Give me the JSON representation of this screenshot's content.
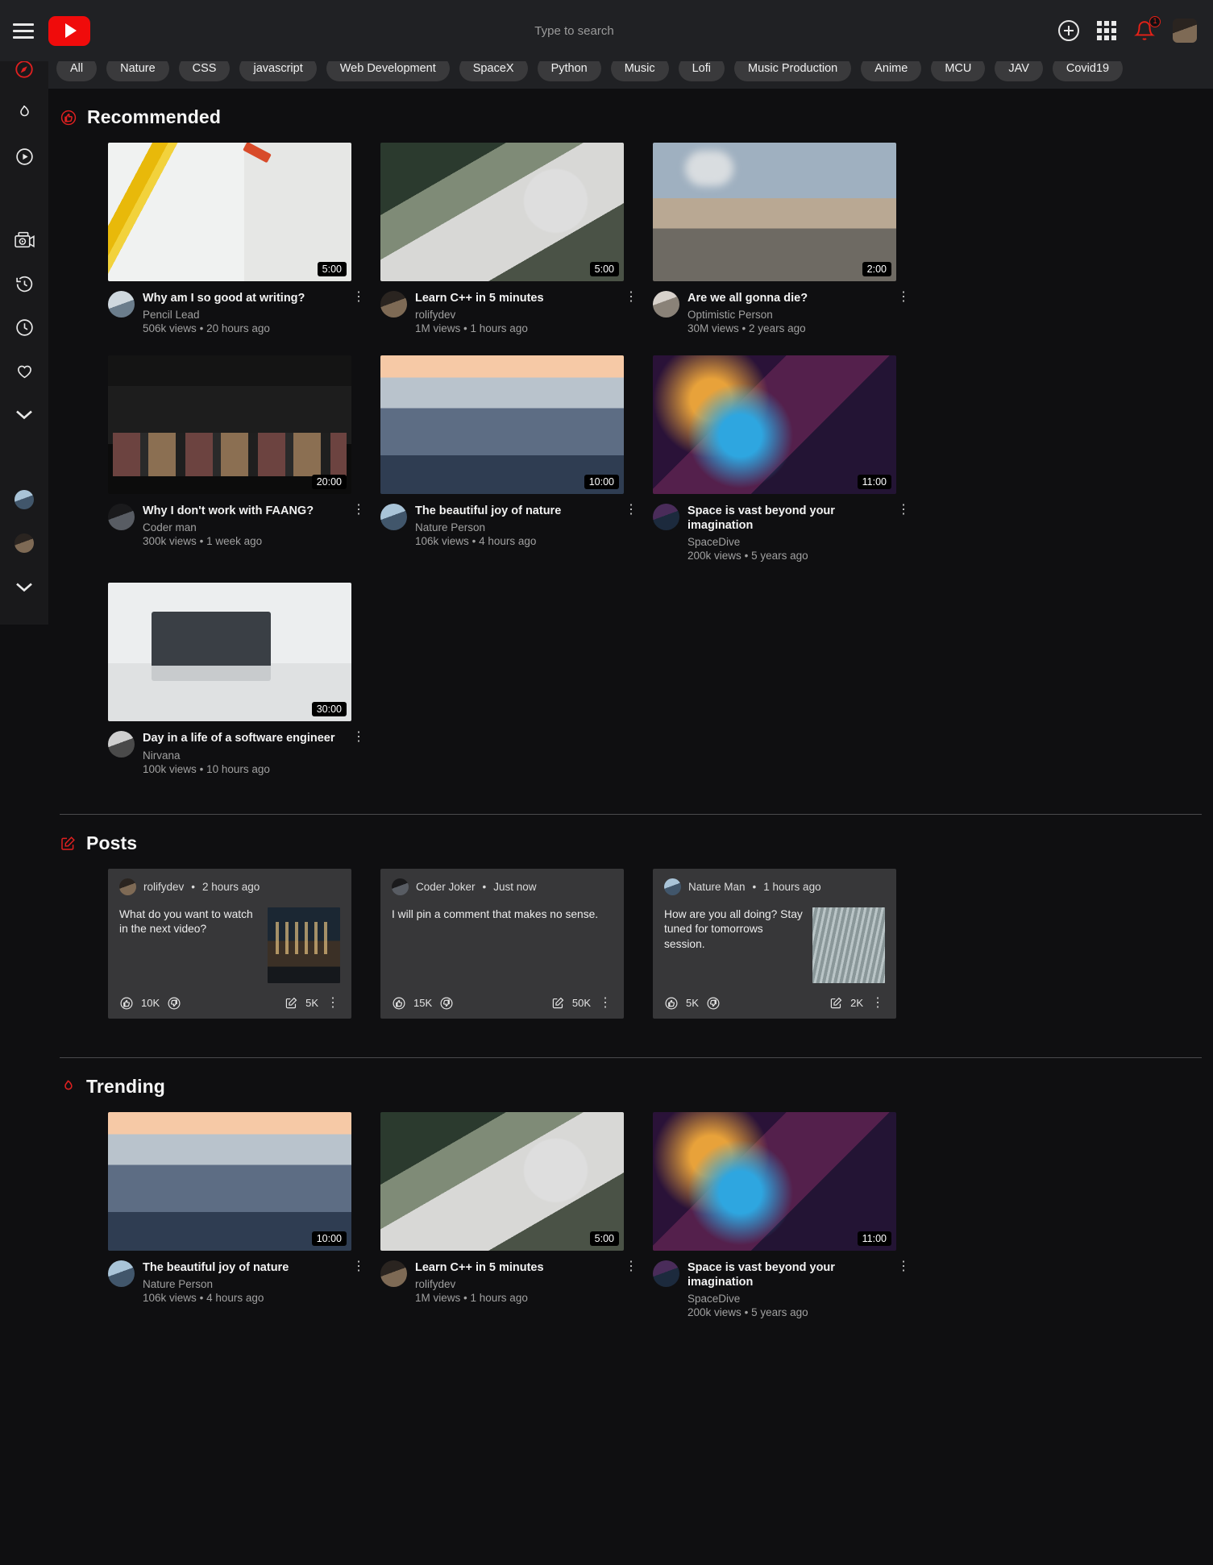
{
  "header": {
    "menu_label": "Menu",
    "logo_label": "YouTube",
    "search_placeholder": "Type to search",
    "search_value": "",
    "create_label": "Create",
    "apps_label": "Apps",
    "notifications_label": "Notifications",
    "notification_count": "1",
    "account_label": "Account"
  },
  "chips": [
    {
      "label": "All"
    },
    {
      "label": "Nature"
    },
    {
      "label": "CSS"
    },
    {
      "label": "javascript"
    },
    {
      "label": "Web Development"
    },
    {
      "label": "SpaceX"
    },
    {
      "label": "Python"
    },
    {
      "label": "Music"
    },
    {
      "label": "Lofi"
    },
    {
      "label": "Music Production"
    },
    {
      "label": "Anime"
    },
    {
      "label": "MCU"
    },
    {
      "label": "JAV"
    },
    {
      "label": "Covid19"
    }
  ],
  "rail": {
    "items": [
      {
        "name": "explore",
        "icon": "compass-icon",
        "color": "#e02020"
      },
      {
        "name": "trending",
        "icon": "fire-icon",
        "color": "#e8e8e8"
      },
      {
        "name": "subscriptions",
        "icon": "play-circle-icon",
        "color": "#e8e8e8"
      },
      {
        "name": "library",
        "icon": "video-library-icon",
        "color": "#e8e8e8"
      },
      {
        "name": "history",
        "icon": "history-icon",
        "color": "#e8e8e8"
      },
      {
        "name": "watch-later",
        "icon": "clock-icon",
        "color": "#e8e8e8"
      },
      {
        "name": "liked-videos",
        "icon": "heart-icon",
        "color": "#e8e8e8"
      },
      {
        "name": "show-more",
        "icon": "chevron-down-icon",
        "color": "#e8e8e8"
      }
    ],
    "subscriptions": [
      {
        "name": "subscription-1",
        "art": "art-av5"
      },
      {
        "name": "subscription-2",
        "art": "art-av2"
      }
    ],
    "show_more_icon": "chevron-down-icon"
  },
  "sections": {
    "recommended": {
      "title": "Recommended",
      "icon": "thumbs-up-circle-icon",
      "icon_color": "#e02020",
      "videos": [
        {
          "title": "Why am I so good at writing?",
          "channel": "Pencil Lead",
          "views": "506k views",
          "age": "20 hours ago",
          "duration": "5:00",
          "art": "art-pencil",
          "avatar_art": "art-av1"
        },
        {
          "title": "Learn C++ in 5 minutes",
          "channel": "rolifydev",
          "views": "1M views",
          "age": "1 hours ago",
          "duration": "5:00",
          "art": "art-laptop",
          "avatar_art": "art-av2"
        },
        {
          "title": "Are we all gonna die?",
          "channel": "Optimistic Person",
          "views": "30M views",
          "age": "2 years ago",
          "duration": "2:00",
          "art": "art-factory",
          "avatar_art": "art-av3"
        },
        {
          "title": "Why I don't work with FAANG?",
          "channel": "Coder man",
          "views": "300k views",
          "age": "1 week ago",
          "duration": "20:00",
          "art": "art-browser",
          "avatar_art": "art-av4"
        },
        {
          "title": "The beautiful joy of nature",
          "channel": "Nature Person",
          "views": "106k views",
          "age": "4 hours ago",
          "duration": "10:00",
          "art": "art-ocean",
          "avatar_art": "art-av5"
        },
        {
          "title": "Space is vast beyond your imagination",
          "channel": "SpaceDive",
          "views": "200k views",
          "age": "5 years ago",
          "duration": "11:00",
          "art": "art-space",
          "avatar_art": "art-av6"
        },
        {
          "title": "Day in a life of a software engineer",
          "channel": "Nirvana",
          "views": "100k views",
          "age": "10 hours ago",
          "duration": "30:00",
          "art": "art-desk",
          "avatar_art": "art-av7"
        }
      ]
    },
    "posts": {
      "title": "Posts",
      "icon": "edit-square-icon",
      "icon_color": "#e02020",
      "items": [
        {
          "author": "rolifydev",
          "age": "2 hours ago",
          "separator": "•",
          "text": "What do you want to watch in the next video?",
          "likes": "10K",
          "shares": "5K",
          "avatar_art": "art-av2",
          "image_art": "art-city",
          "has_image": true
        },
        {
          "author": "Coder Joker",
          "age": "Just now",
          "separator": "•",
          "text": "I will pin a comment that makes no sense.",
          "likes": "15K",
          "shares": "50K",
          "avatar_art": "art-av4",
          "image_art": "",
          "has_image": false
        },
        {
          "author": "Nature Man",
          "age": "1 hours ago",
          "separator": "•",
          "text": "How are you all doing? Stay tuned for tomorrows session.",
          "likes": "5K",
          "shares": "2K",
          "avatar_art": "art-av5",
          "image_art": "art-rain",
          "has_image": true
        }
      ],
      "icons": {
        "like": "thumbs-up-circle-icon",
        "dislike": "thumbs-down-circle-icon",
        "share": "share-square-icon",
        "menu": "kebab-menu-icon"
      }
    },
    "trending": {
      "title": "Trending",
      "icon": "fire-icon",
      "icon_color": "#e02020",
      "videos": [
        {
          "title": "The beautiful joy of nature",
          "channel": "Nature Person",
          "views": "106k views",
          "age": "4 hours ago",
          "duration": "10:00",
          "art": "art-ocean",
          "avatar_art": "art-av5"
        },
        {
          "title": "Learn C++ in 5 minutes",
          "channel": "rolifydev",
          "views": "1M views",
          "age": "1 hours ago",
          "duration": "5:00",
          "art": "art-laptop",
          "avatar_art": "art-av2"
        },
        {
          "title": "Space is vast beyond your imagination",
          "channel": "SpaceDive",
          "views": "200k views",
          "age": "5 years ago",
          "duration": "11:00",
          "art": "art-space",
          "avatar_art": "art-av6"
        }
      ]
    }
  },
  "common": {
    "kebab": "⋮",
    "dot_separator": "•"
  }
}
